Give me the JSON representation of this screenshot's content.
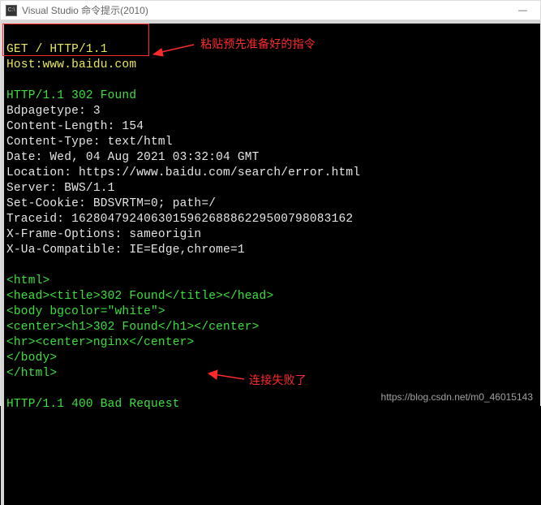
{
  "titlebar": {
    "icon_label": "C:\\",
    "title": "Visual Studio 命令提示(2010)",
    "minimize_glyph": "—"
  },
  "terminal": {
    "request_line": "GET / HTTP/1.1",
    "host_line": "Host:www.baidu.com",
    "status_line": "HTTP/1.1 302 Found",
    "headers": [
      "Bdpagetype: 3",
      "Content-Length: 154",
      "Content-Type: text/html",
      "Date: Wed, 04 Aug 2021 03:32:04 GMT",
      "Location: https://www.baidu.com/search/error.html",
      "Server: BWS/1.1",
      "Set-Cookie: BDSVRTM=0; path=/",
      "Traceid: 162804792406301596268886229500798083162",
      "X-Frame-Options: sameorigin",
      "X-Ua-Compatible: IE=Edge,chrome=1"
    ],
    "body_lines": [
      "<html>",
      "<head><title>302 Found</title></head>",
      "<body bgcolor=\"white\">",
      "<center><h1>302 Found</h1></center>",
      "<hr><center>nginx</center>",
      "</body>",
      "</html>"
    ],
    "bad_request_line": "HTTP/1.1 400 Bad Request"
  },
  "annotations": {
    "top_note": "粘贴预先准备好的指令",
    "bottom_note": "连接失败了"
  },
  "watermark": "https://blog.csdn.net/m0_46015143"
}
